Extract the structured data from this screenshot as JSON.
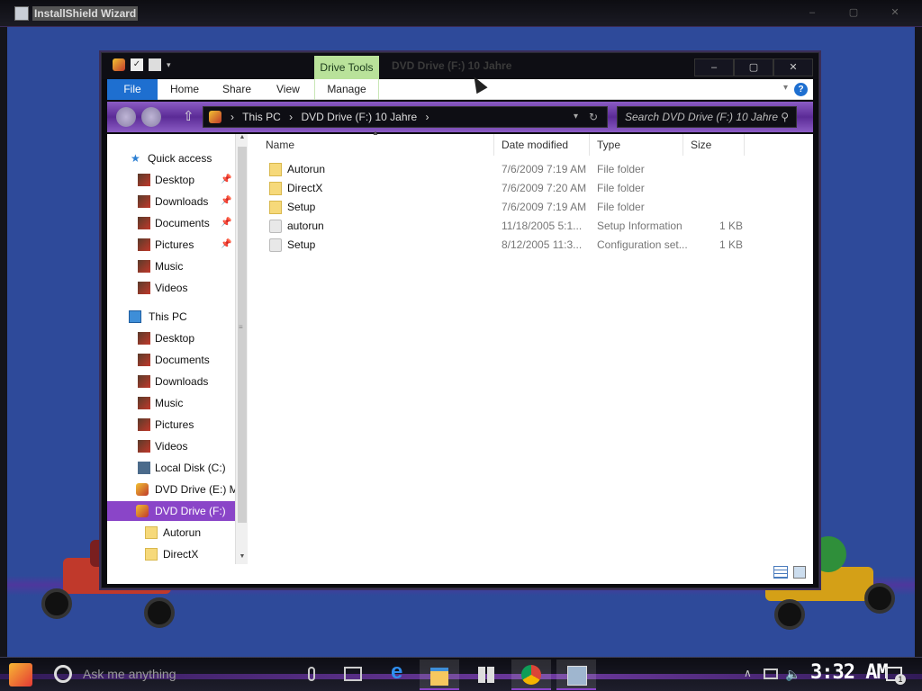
{
  "outer_window": {
    "title": "InstallShield Wizard",
    "controls": [
      "–",
      "▢",
      "✕"
    ]
  },
  "explorer": {
    "title": "DVD Drive (F:) 10 Jahre",
    "contextual_tab": "Drive Tools",
    "window_controls": [
      "–",
      "▢",
      "✕"
    ],
    "ribbon_tabs": {
      "file": "File",
      "home": "Home",
      "share": "Share",
      "view": "View",
      "manage": "Manage"
    },
    "help_glyph": "?",
    "address": {
      "crumbs": [
        "This PC",
        "›",
        "DVD Drive (F:) 10 Jahre",
        "›"
      ],
      "lead_arrow": "›"
    },
    "search_placeholder": "Search DVD Drive (F:) 10 Jahre",
    "nav": {
      "quick_access": "Quick access",
      "quick_items": [
        "Desktop",
        "Downloads",
        "Documents",
        "Pictures",
        "Music",
        "Videos"
      ],
      "this_pc": "This PC",
      "pc_items": [
        "Desktop",
        "Documents",
        "Downloads",
        "Music",
        "Pictures",
        "Videos",
        "Local Disk (C:)",
        "DVD Drive (E:) M",
        "DVD Drive (F:)",
        "Autorun",
        "DirectX"
      ]
    },
    "columns": {
      "name": "Name",
      "date": "Date modified",
      "type": "Type",
      "size": "Size"
    },
    "files": [
      {
        "name": "Autorun",
        "date": "7/6/2009 7:19 AM",
        "type": "File folder",
        "size": "",
        "icon": "folder-icon"
      },
      {
        "name": "DirectX",
        "date": "7/6/2009 7:20 AM",
        "type": "File folder",
        "size": "",
        "icon": "folder-icon"
      },
      {
        "name": "Setup",
        "date": "7/6/2009 7:19 AM",
        "type": "File folder",
        "size": "",
        "icon": "folder-icon"
      },
      {
        "name": "autorun",
        "date": "11/18/2005 5:1...",
        "type": "Setup Information",
        "size": "1 KB",
        "icon": "setup-file-icon"
      },
      {
        "name": "Setup",
        "date": "8/12/2005 11:3...",
        "type": "Configuration set...",
        "size": "1 KB",
        "icon": "config-file-icon"
      }
    ]
  },
  "taskbar": {
    "search_text": "Ask me anything",
    "clock": "3:32 AM",
    "notification_count": "1"
  },
  "colors": {
    "desktop_blue": "#2e4a9a",
    "accent_purple": "#8a45c8",
    "file_tab_blue": "#1e6fd0",
    "drive_tools_green": "#b9e29a"
  }
}
